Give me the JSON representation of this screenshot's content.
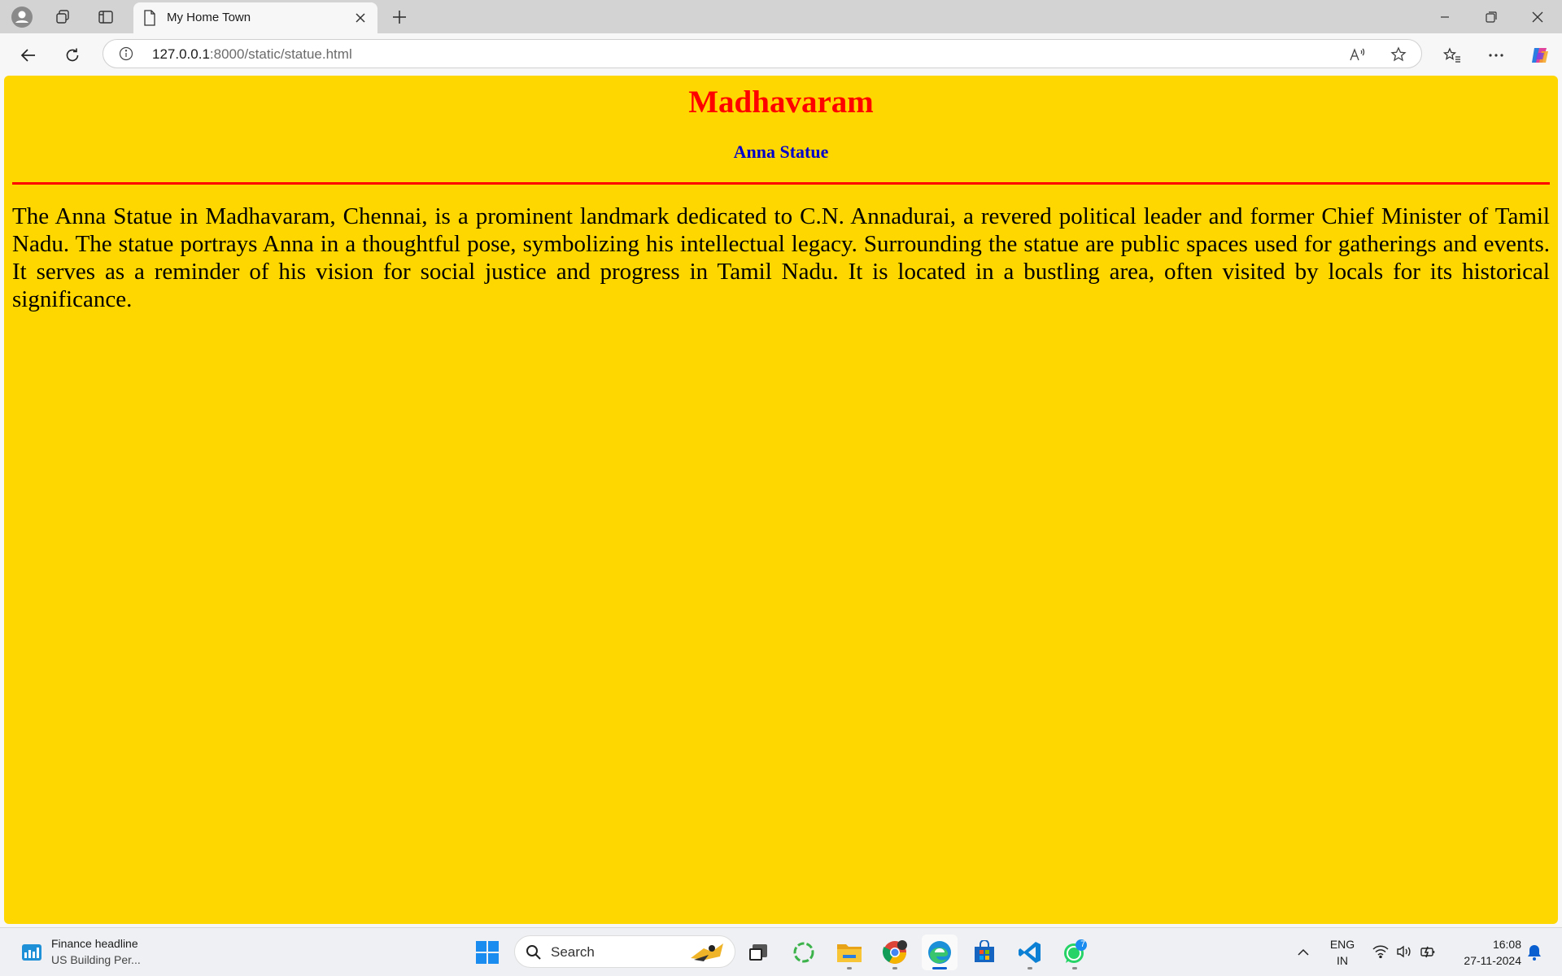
{
  "browser": {
    "tab": {
      "title": "My Home Town"
    },
    "address": {
      "host": "127.0.0.1",
      "rest": ":8000/static/statue.html"
    }
  },
  "page": {
    "heading": "Madhavaram",
    "subheading": "Anna Statue",
    "paragraph": "The Anna Statue in Madhavaram, Chennai, is a prominent landmark dedicated to C.N. Annadurai, a revered political leader and former Chief Minister of Tamil Nadu. The statue portrays Anna in a thoughtful pose, symbolizing his intellectual legacy. Surrounding the statue are public spaces used for gatherings and events. It serves as a reminder of his vision for social justice and progress in Tamil Nadu. It is located in a bustling area, often visited by locals for its historical significance.",
    "colors": {
      "background": "#ffd700",
      "heading": "#ff0000",
      "subheading": "#0000cc",
      "rule": "#ff0000"
    }
  },
  "taskbar": {
    "widget": {
      "title": "Finance headline",
      "subtitle": "US Building Per..."
    },
    "search_placeholder": "Search",
    "apps": [
      "start-icon",
      "search-box",
      "task-view-icon",
      "copilot-app-icon",
      "file-explorer-icon",
      "chrome-icon",
      "edge-icon",
      "microsoft-store-icon",
      "vscode-icon",
      "whatsapp-icon"
    ],
    "whatsapp_badge": "7",
    "tray": {
      "lang_line1": "ENG",
      "lang_line2": "IN",
      "time": "16:08",
      "date": "27-11-2024"
    }
  }
}
